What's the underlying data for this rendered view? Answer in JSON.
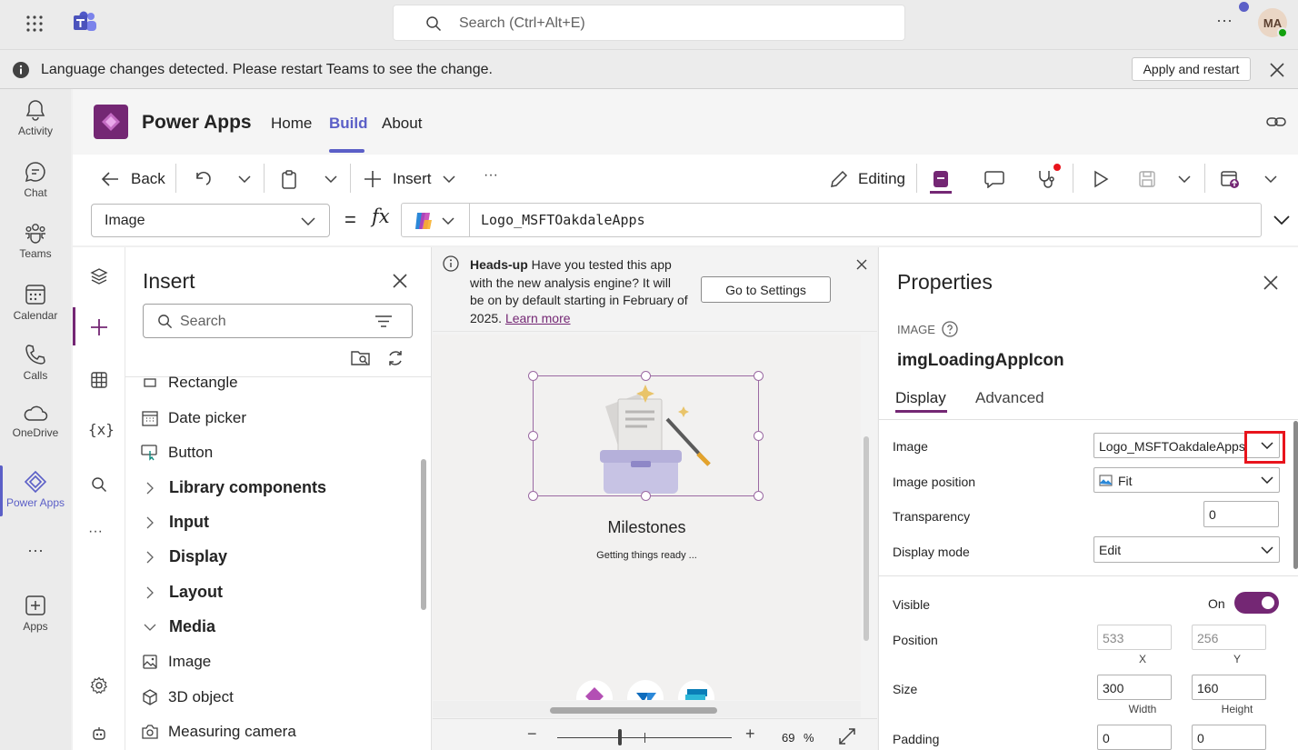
{
  "teams": {
    "search_placeholder": "Search (Ctrl+Alt+E)",
    "more_label": "···",
    "avatar_initials": "MA",
    "notice": {
      "text": "Language changes detected. Please restart Teams to see the change.",
      "apply_label": "Apply and restart"
    },
    "rail": [
      {
        "label": "Activity"
      },
      {
        "label": "Chat"
      },
      {
        "label": "Teams"
      },
      {
        "label": "Calendar"
      },
      {
        "label": "Calls"
      },
      {
        "label": "OneDrive"
      },
      {
        "label": "Power Apps"
      },
      {
        "label": "···"
      },
      {
        "label": "Apps"
      }
    ]
  },
  "app": {
    "title": "Power Apps",
    "tabs": [
      "Home",
      "Build",
      "About"
    ],
    "active_tab": "Build"
  },
  "toolbar": {
    "back_label": "Back",
    "insert_label": "Insert",
    "more_label": "···",
    "editing_label": "Editing"
  },
  "formula_bar": {
    "control": "Image",
    "equals": "=",
    "fx": "fx",
    "value": "Logo_MSFTOakdaleApps"
  },
  "insert_panel": {
    "title": "Insert",
    "search_placeholder": "Search",
    "items": [
      {
        "kind": "item",
        "label": "Rectangle",
        "icon": "rectangle-icon"
      },
      {
        "kind": "item",
        "label": "Date picker",
        "icon": "calendar-icon"
      },
      {
        "kind": "item",
        "label": "Button",
        "icon": "button-icon"
      },
      {
        "kind": "group",
        "label": "Library components",
        "expanded": false
      },
      {
        "kind": "group",
        "label": "Input",
        "expanded": false
      },
      {
        "kind": "group",
        "label": "Display",
        "expanded": false
      },
      {
        "kind": "group",
        "label": "Layout",
        "expanded": false
      },
      {
        "kind": "group",
        "label": "Media",
        "expanded": true
      },
      {
        "kind": "item",
        "label": "Image",
        "icon": "image-icon"
      },
      {
        "kind": "item",
        "label": "3D object",
        "icon": "cube-icon"
      },
      {
        "kind": "item",
        "label": "Measuring camera",
        "icon": "camera-icon"
      }
    ]
  },
  "canvas": {
    "headsup_bold": "Heads-up",
    "headsup_text": " Have you tested this app with the new analysis engine? It will be on by default starting in February of 2025. ",
    "headsup_link": "Learn more",
    "go_settings_label": "Go to Settings",
    "screen_title": "Milestones",
    "screen_subtitle": "Getting things ready ...",
    "zoom_value": "69",
    "zoom_unit": "%",
    "zoom_level": 0.69
  },
  "properties": {
    "title": "Properties",
    "type_label": "IMAGE",
    "control_name": "imgLoadingAppIcon",
    "tabs": [
      "Display",
      "Advanced"
    ],
    "active_tab": "Display",
    "image_label": "Image",
    "image_value": "Logo_MSFTOakdaleApps",
    "image_position_label": "Image position",
    "image_position_value": "Fit",
    "transparency_label": "Transparency",
    "transparency_value": "0",
    "display_mode_label": "Display mode",
    "display_mode_value": "Edit",
    "visible_label": "Visible",
    "visible_value": "On",
    "position_label": "Position",
    "position_x": "533",
    "position_y": "256",
    "x_caption": "X",
    "y_caption": "Y",
    "size_label": "Size",
    "width_value": "300",
    "height_value": "160",
    "width_caption": "Width",
    "height_caption": "Height",
    "padding_label": "Padding",
    "padding_top": "0",
    "padding_bottom": "0"
  },
  "colors": {
    "powerapps_purple": "#742774",
    "teams_accent": "#5b5fc7",
    "highlight_red": "#e8141c"
  }
}
